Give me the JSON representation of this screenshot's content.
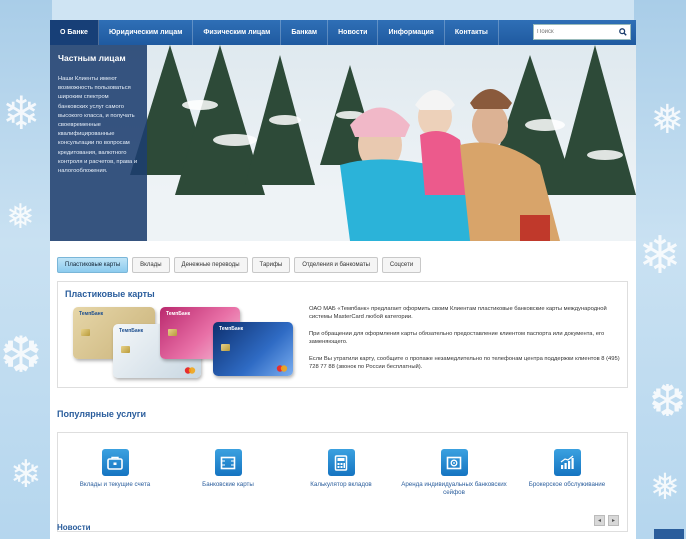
{
  "nav": {
    "items": [
      {
        "label": "О Банке",
        "active": true
      },
      {
        "label": "Юридическим лицам",
        "active": false
      },
      {
        "label": "Физическим лицам",
        "active": false
      },
      {
        "label": "Банкам",
        "active": false
      },
      {
        "label": "Новости",
        "active": false
      },
      {
        "label": "Информация",
        "active": false
      },
      {
        "label": "Контакты",
        "active": false
      }
    ],
    "search_placeholder": "Поиск"
  },
  "hero": {
    "title": "Частным лицам",
    "text": "Наши Клиенты имеют возможность пользоваться широким спектром банковских услуг самого высокого класса, и получать своевременные квалифицированные консультации по вопросам кредитования, валютного контроля и расчетов, права и налогообложения."
  },
  "tabs": [
    {
      "label": "Пластиковые карты",
      "active": true
    },
    {
      "label": "Вклады",
      "active": false
    },
    {
      "label": "Денежные переводы",
      "active": false
    },
    {
      "label": "Тарифы",
      "active": false
    },
    {
      "label": "Отделения и банкоматы",
      "active": false
    },
    {
      "label": "Соцсети",
      "active": false
    }
  ],
  "cards_panel": {
    "title": "Пластиковые карты",
    "card_brand": "ТемпБанк",
    "paragraphs": [
      "ОАО МАБ «Темпбанк» предлагает оформить своим Клиентам пластиковые банковские карты международной системы MasterCard любой категории.",
      "При обращении для оформления карты обязательно предоставление клиентом паспорта или документа, его заменяющего.",
      "Если Вы утратили карту, сообщите о пропаже незамедлительно по телефонам центра поддержки клиентов 8 (495) 728 77 88 (звонок по России бесплатный)."
    ]
  },
  "popular": {
    "title": "Популярные услуги",
    "items": [
      {
        "label": "Вклады и текущие счета",
        "icon": "wallet-icon"
      },
      {
        "label": "Банковские карты",
        "icon": "card-icon"
      },
      {
        "label": "Калькулятор вкладов",
        "icon": "calculator-icon"
      },
      {
        "label": "Аренда индивидуальных банковских сейфов",
        "icon": "safe-icon"
      },
      {
        "label": "Брокерское обслуживание",
        "icon": "chart-icon"
      }
    ],
    "prev_label": "◂",
    "next_label": "▸"
  },
  "news": {
    "title": "Новости"
  },
  "colors": {
    "nav": "#1f5aa0",
    "accent": "#2a5d9c",
    "icon": "#1574c1"
  }
}
